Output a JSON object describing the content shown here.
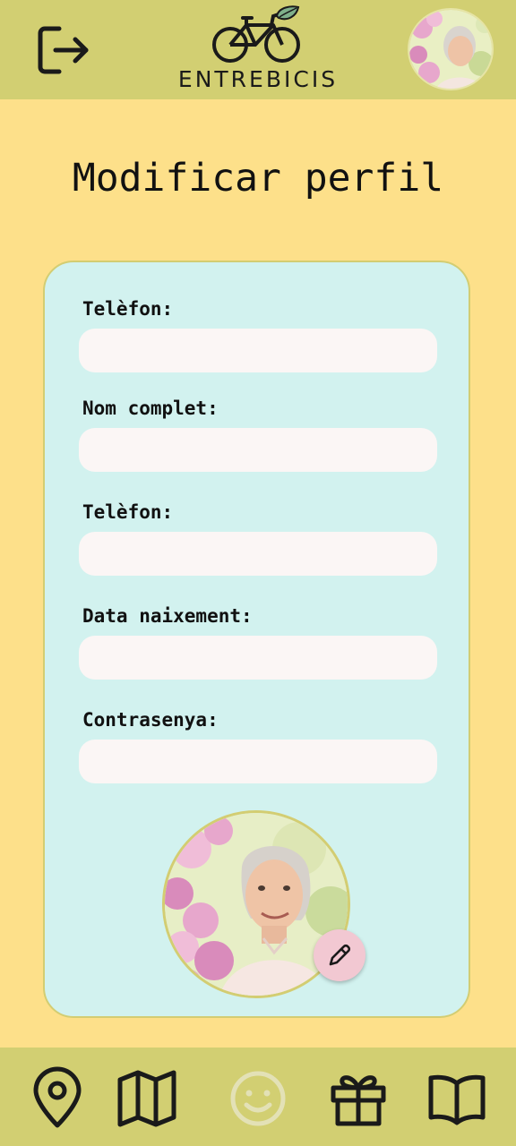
{
  "header": {
    "logout_icon": "logout-arrow-icon",
    "logo_text": "ENTREBICIS",
    "logo_icon": "bicycle-leaf-icon"
  },
  "page": {
    "title": "Modificar perfil"
  },
  "form": {
    "fields": [
      {
        "label": "Telèfon:",
        "value": "",
        "placeholder": ""
      },
      {
        "label": "Nom complet:",
        "value": "",
        "placeholder": ""
      },
      {
        "label": "Telèfon:",
        "value": "",
        "placeholder": ""
      },
      {
        "label": "Data naixement:",
        "value": "",
        "placeholder": ""
      },
      {
        "label": "Contrasenya:",
        "value": "",
        "placeholder": ""
      }
    ],
    "edit_icon": "pencil-icon"
  },
  "bottom_nav": {
    "items": [
      {
        "icon": "location-pin-icon",
        "active": false
      },
      {
        "icon": "map-icon",
        "active": false
      },
      {
        "icon": "smiley-icon",
        "active": true
      },
      {
        "icon": "gift-icon",
        "active": false
      },
      {
        "icon": "book-icon",
        "active": false
      }
    ]
  },
  "colors": {
    "background": "#FDE08A",
    "header": "#D2CF72",
    "card": "#D2F2EF",
    "input": "#FBF6F5",
    "edit_button": "#F2C8D2",
    "active_nav": "#E3E1B6"
  }
}
